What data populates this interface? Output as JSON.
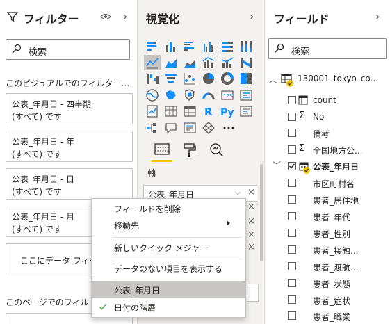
{
  "filters": {
    "title": "フィルター",
    "search_placeholder": "検索",
    "visual_section": "このビジュアルでのフィルター...",
    "cards": [
      {
        "title": "公表_年月日 - 四半期",
        "value": "(すべて) です"
      },
      {
        "title": "公表_年月日 - 年",
        "value": "(すべて) です"
      },
      {
        "title": "公表_年月日 - 日",
        "value": "(すべて) です"
      },
      {
        "title": "公表_年月日 - 月",
        "value": "(すべて) です"
      }
    ],
    "drop_text": "ここにデータ フィー",
    "page_section": "このページでのフィル"
  },
  "viz": {
    "title": "視覚化",
    "axis_label": "軸",
    "well_value": "公表_年月日"
  },
  "fields": {
    "title": "フィールド",
    "search_placeholder": "検索",
    "table_name": "130001_tokyo_co...",
    "items": [
      {
        "label": "count",
        "icon": "calc-table-icon"
      },
      {
        "label": "No",
        "icon": "sigma-icon"
      },
      {
        "label": "備考",
        "icon": ""
      },
      {
        "label": "全国地方公...",
        "icon": "sigma-icon"
      }
    ],
    "date_field": "公表_年月日",
    "sub_items": [
      "市区町村名",
      "患者_居住地",
      "患者_年代",
      "患者_性別",
      "患者_接触...",
      "患者_渡航...",
      "患者_状態",
      "患者_症状",
      "患者_職業"
    ]
  },
  "context_menu": {
    "items": [
      {
        "label": "フィールドを削除"
      },
      {
        "label": "移動先"
      },
      {
        "label": "新しいクイック メジャー"
      },
      {
        "label": "データのない項目を表示する"
      },
      {
        "label": "公表_年月日"
      },
      {
        "label": "日付の階層"
      }
    ]
  },
  "colors": {
    "accent": "#f2c811",
    "selected": "#c8c6c4",
    "icon": "#605e5c",
    "check_green": "#4caf50"
  }
}
